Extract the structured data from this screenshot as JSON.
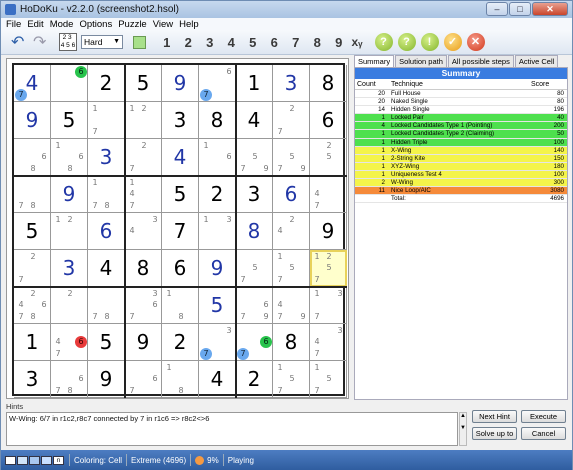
{
  "window": {
    "title": "HoDoKu - v2.2.0  (screenshot2.hsol)",
    "min": "–",
    "max": "□",
    "close": "✕"
  },
  "menu": [
    "File",
    "Edit",
    "Mode",
    "Options",
    "Puzzle",
    "View",
    "Help"
  ],
  "toolbar": {
    "undo_icon": "undo-arrow",
    "redo_icon": "redo-arrow",
    "toggle_text": "2 3 \n4 5 6",
    "level": "Hard",
    "digits": [
      "1",
      "2",
      "3",
      "4",
      "5",
      "6",
      "7",
      "8",
      "9"
    ],
    "xy": "xᵧ",
    "circles": [
      {
        "t": "?",
        "c": "g"
      },
      {
        "t": "?",
        "c": "g"
      },
      {
        "t": "!",
        "c": "g"
      },
      {
        "t": "✓",
        "c": "o"
      },
      {
        "t": "✕",
        "c": "r"
      }
    ]
  },
  "colors": {
    "highlight_blue": "#69a8ee",
    "highlight_green": "#28c34c",
    "highlight_red": "#e83b3b",
    "summary_header": "#3a7ce0",
    "green_row": "#4ee04e",
    "yellow_row": "#f4f44a",
    "orange_row": "#f58a3a",
    "selected_cell": "#ffffcc"
  },
  "board": [
    [
      {
        "v": "4",
        "u": 1,
        "c": [
          {
            "n": "7",
            "p": 7,
            "h": "b"
          }
        ]
      },
      {
        "c": [
          {
            "n": "6",
            "p": 3,
            "h": "g"
          }
        ]
      },
      {
        "v": "2"
      },
      {
        "v": "5"
      },
      {
        "v": "9",
        "u": 1
      },
      {
        "c": [
          {
            "n": "6",
            "p": 3
          },
          {
            "n": "7",
            "p": 7,
            "h": "b"
          }
        ]
      },
      {
        "v": "1"
      },
      {
        "v": "3",
        "u": 1
      },
      {
        "v": "8"
      }
    ],
    [
      {
        "v": "9",
        "u": 1
      },
      {
        "v": "5"
      },
      {
        "c": [
          {
            "n": "1",
            "p": 1
          },
          {
            "n": "7",
            "p": 7
          }
        ]
      },
      {
        "c": [
          {
            "n": "1",
            "p": 1
          },
          {
            "n": "2",
            "p": 2
          }
        ]
      },
      {
        "v": "3"
      },
      {
        "v": "8"
      },
      {
        "v": "4"
      },
      {
        "c": [
          {
            "n": "2",
            "p": 2
          },
          {
            "n": "7",
            "p": 7
          }
        ]
      },
      {
        "v": "6"
      }
    ],
    [
      {
        "c": [
          {
            "n": "6",
            "p": 6
          },
          {
            "n": "8",
            "p": 8
          }
        ]
      },
      {
        "c": [
          {
            "n": "1",
            "p": 1
          },
          {
            "n": "6",
            "p": 6
          },
          {
            "n": "8",
            "p": 8
          }
        ]
      },
      {
        "v": "3",
        "u": 1
      },
      {
        "c": [
          {
            "n": "2",
            "p": 2
          },
          {
            "n": "7",
            "p": 7
          }
        ]
      },
      {
        "v": "4",
        "u": 1
      },
      {
        "c": [
          {
            "n": "1",
            "p": 1
          },
          {
            "n": "6",
            "p": 6
          }
        ]
      },
      {
        "c": [
          {
            "n": "5",
            "p": 5
          },
          {
            "n": "7",
            "p": 7
          },
          {
            "n": "9",
            "p": 9
          }
        ]
      },
      {
        "c": [
          {
            "n": "5",
            "p": 5
          },
          {
            "n": "7",
            "p": 7
          },
          {
            "n": "9",
            "p": 9
          }
        ]
      },
      {
        "c": [
          {
            "n": "2",
            "p": 2
          },
          {
            "n": "5",
            "p": 5
          }
        ]
      }
    ],
    [
      {
        "c": [
          {
            "n": "7",
            "p": 7
          },
          {
            "n": "8",
            "p": 8
          }
        ]
      },
      {
        "v": "9",
        "u": 1
      },
      {
        "c": [
          {
            "n": "1",
            "p": 1
          },
          {
            "n": "7",
            "p": 7
          },
          {
            "n": "8",
            "p": 8
          }
        ]
      },
      {
        "c": [
          {
            "n": "1",
            "p": 1
          },
          {
            "n": "4",
            "p": 4
          },
          {
            "n": "7",
            "p": 7
          }
        ]
      },
      {
        "v": "5"
      },
      {
        "v": "2"
      },
      {
        "v": "3"
      },
      {
        "v": "6",
        "u": 1
      },
      {
        "c": [
          {
            "n": "4",
            "p": 4
          },
          {
            "n": "7",
            "p": 7
          }
        ]
      }
    ],
    [
      {
        "v": "5"
      },
      {
        "c": [
          {
            "n": "1",
            "p": 1
          },
          {
            "n": "2",
            "p": 2
          }
        ]
      },
      {
        "v": "6",
        "u": 1
      },
      {
        "c": [
          {
            "n": "3",
            "p": 3
          },
          {
            "n": "4",
            "p": 4
          }
        ]
      },
      {
        "v": "7"
      },
      {
        "c": [
          {
            "n": "1",
            "p": 1
          },
          {
            "n": "3",
            "p": 3
          }
        ]
      },
      {
        "v": "8",
        "u": 1
      },
      {
        "c": [
          {
            "n": "2",
            "p": 2
          },
          {
            "n": "4",
            "p": 4
          }
        ]
      },
      {
        "v": "9"
      }
    ],
    [
      {
        "c": [
          {
            "n": "2",
            "p": 2
          },
          {
            "n": "7",
            "p": 7
          }
        ]
      },
      {
        "v": "3",
        "u": 1
      },
      {
        "v": "4"
      },
      {
        "v": "8"
      },
      {
        "v": "6"
      },
      {
        "v": "9",
        "u": 1
      },
      {
        "c": [
          {
            "n": "5",
            "p": 5
          },
          {
            "n": "7",
            "p": 7
          }
        ]
      },
      {
        "c": [
          {
            "n": "1",
            "p": 1
          },
          {
            "n": "5",
            "p": 5
          },
          {
            "n": "7",
            "p": 7
          }
        ]
      },
      {
        "sel": 1,
        "c": [
          {
            "n": "1",
            "p": 1
          },
          {
            "n": "2",
            "p": 2
          },
          {
            "n": "5",
            "p": 5
          },
          {
            "n": "7",
            "p": 7
          }
        ]
      }
    ],
    [
      {
        "c": [
          {
            "n": "2",
            "p": 2
          },
          {
            "n": "4",
            "p": 4
          },
          {
            "n": "6",
            "p": 6
          },
          {
            "n": "7",
            "p": 7
          },
          {
            "n": "8",
            "p": 8
          }
        ]
      },
      {
        "c": [
          {
            "n": "2",
            "p": 2
          }
        ]
      },
      {
        "c": [
          {
            "n": "7",
            "p": 7
          },
          {
            "n": "8",
            "p": 8
          }
        ]
      },
      {
        "c": [
          {
            "n": "3",
            "p": 3
          },
          {
            "n": "6",
            "p": 6
          },
          {
            "n": "7",
            "p": 7
          }
        ]
      },
      {
        "c": [
          {
            "n": "1",
            "p": 1
          },
          {
            "n": "8",
            "p": 8
          }
        ]
      },
      {
        "v": "5",
        "u": 1
      },
      {
        "c": [
          {
            "n": "6",
            "p": 6
          },
          {
            "n": "7",
            "p": 7
          },
          {
            "n": "9",
            "p": 9
          }
        ]
      },
      {
        "c": [
          {
            "n": "4",
            "p": 4
          },
          {
            "n": "7",
            "p": 7
          },
          {
            "n": "9",
            "p": 9
          }
        ]
      },
      {
        "c": [
          {
            "n": "1",
            "p": 1
          },
          {
            "n": "3",
            "p": 3
          },
          {
            "n": "7",
            "p": 7
          }
        ]
      }
    ],
    [
      {
        "v": "1"
      },
      {
        "c": [
          {
            "n": "4",
            "p": 4
          },
          {
            "n": "7",
            "p": 7
          },
          {
            "n": "6",
            "p": 6,
            "h": "r"
          }
        ]
      },
      {
        "v": "5"
      },
      {
        "v": "9"
      },
      {
        "v": "2"
      },
      {
        "c": [
          {
            "n": "3",
            "p": 3
          },
          {
            "n": "7",
            "p": 7,
            "h": "b"
          }
        ]
      },
      {
        "c": [
          {
            "n": "6",
            "p": 6,
            "h": "g"
          },
          {
            "n": "7",
            "p": 7,
            "h": "b"
          }
        ]
      },
      {
        "v": "8"
      },
      {
        "c": [
          {
            "n": "3",
            "p": 3
          },
          {
            "n": "4",
            "p": 4
          },
          {
            "n": "7",
            "p": 7
          }
        ]
      }
    ],
    [
      {
        "v": "3"
      },
      {
        "c": [
          {
            "n": "6",
            "p": 6
          },
          {
            "n": "7",
            "p": 7
          },
          {
            "n": "8",
            "p": 8
          }
        ]
      },
      {
        "v": "9"
      },
      {
        "c": [
          {
            "n": "6",
            "p": 6
          },
          {
            "n": "7",
            "p": 7
          }
        ]
      },
      {
        "c": [
          {
            "n": "1",
            "p": 1
          },
          {
            "n": "8",
            "p": 8
          }
        ]
      },
      {
        "v": "4"
      },
      {
        "v": "2"
      },
      {
        "c": [
          {
            "n": "1",
            "p": 1
          },
          {
            "n": "5",
            "p": 5
          },
          {
            "n": "7",
            "p": 7
          }
        ]
      },
      {
        "c": [
          {
            "n": "1",
            "p": 1
          },
          {
            "n": "5",
            "p": 5
          },
          {
            "n": "7",
            "p": 7
          }
        ]
      }
    ]
  ],
  "tabs": [
    "Summary",
    "Solution path",
    "All possible steps",
    "Active Cell"
  ],
  "summary": {
    "header": "Summary",
    "columns": [
      "Count",
      "Technique",
      "Score"
    ],
    "rows": [
      {
        "count": "20",
        "tech": "Full House",
        "score": "80",
        "bg": ""
      },
      {
        "count": "20",
        "tech": "Naked Single",
        "score": "80",
        "bg": ""
      },
      {
        "count": "14",
        "tech": "Hidden Single",
        "score": "196",
        "bg": ""
      },
      {
        "count": "1",
        "tech": "Locked Pair",
        "score": "40",
        "bg": "g"
      },
      {
        "count": "4",
        "tech": "Locked Candidates Type 1 (Pointing)",
        "score": "200",
        "bg": "g"
      },
      {
        "count": "1",
        "tech": "Locked Candidates Type 2 (Claiming)",
        "score": "50",
        "bg": "g"
      },
      {
        "count": "1",
        "tech": "Hidden Triple",
        "score": "100",
        "bg": "g"
      },
      {
        "count": "1",
        "tech": "X-Wing",
        "score": "140",
        "bg": "y"
      },
      {
        "count": "1",
        "tech": "2-String Kite",
        "score": "150",
        "bg": "y"
      },
      {
        "count": "1",
        "tech": "XYZ-Wing",
        "score": "180",
        "bg": "y"
      },
      {
        "count": "1",
        "tech": "Uniqueness Test 4",
        "score": "100",
        "bg": "y"
      },
      {
        "count": "2",
        "tech": "W-Wing",
        "score": "300",
        "bg": "y"
      },
      {
        "count": "11",
        "tech": "Nice Loop/AIC",
        "score": "3080",
        "bg": "o"
      },
      {
        "count": "",
        "tech": "Total:",
        "score": "4696",
        "bg": ""
      }
    ]
  },
  "hints": {
    "label": "Hints",
    "text": "W-Wing: 6/7 in r1c2,r8c7 connected by 7 in r1c6 => r8c2<>6",
    "next": "Next Hint",
    "execute": "Execute",
    "solve_up_to": "Solve up to",
    "cancel": "Cancel"
  },
  "status": {
    "mode": "n",
    "coloring": "Coloring: Cell",
    "level": "Extreme (4696)",
    "progress": "9%",
    "state": "Playing"
  }
}
